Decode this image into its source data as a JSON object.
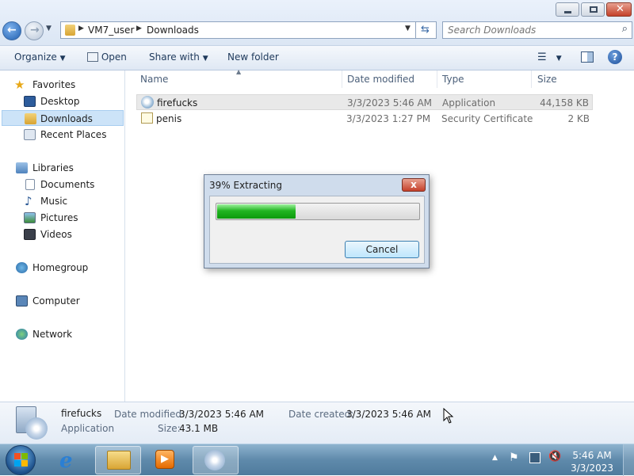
{
  "address": {
    "segments": [
      "VM7_user",
      "Downloads"
    ]
  },
  "search": {
    "placeholder": "Search Downloads"
  },
  "toolbar": {
    "organize": "Organize",
    "open": "Open",
    "share_with": "Share with",
    "new_folder": "New folder"
  },
  "nav": {
    "favorites": "Favorites",
    "favorites_items": [
      "Desktop",
      "Downloads",
      "Recent Places"
    ],
    "libraries": "Libraries",
    "libraries_items": [
      "Documents",
      "Music",
      "Pictures",
      "Videos"
    ],
    "homegroup": "Homegroup",
    "computer": "Computer",
    "network": "Network"
  },
  "columns": {
    "name": "Name",
    "date_modified": "Date modified",
    "type": "Type",
    "size": "Size"
  },
  "files": [
    {
      "name": "firefucks",
      "date": "3/3/2023 5:46 AM",
      "type": "Application",
      "size": "44,158 KB"
    },
    {
      "name": "penis",
      "date": "3/3/2023 1:27 PM",
      "type": "Security Certificate",
      "size": "2 KB"
    }
  ],
  "details": {
    "name": "firefucks",
    "type": "Application",
    "date_modified_label": "Date modified:",
    "date_modified": "3/3/2023 5:46 AM",
    "size_label": "Size:",
    "size": "43.1 MB",
    "date_created_label": "Date created:",
    "date_created": "3/3/2023 5:46 AM"
  },
  "dialog": {
    "title": "39% Extracting",
    "progress": 0.39,
    "cancel": "Cancel",
    "close": "x"
  },
  "taskbar": {
    "time": "5:46 AM",
    "date": "3/3/2023"
  },
  "colors": {
    "accent": "#1f5fb0",
    "progress": "#22b522",
    "close": "#c5402a",
    "taskbar": "#5f8aab"
  }
}
